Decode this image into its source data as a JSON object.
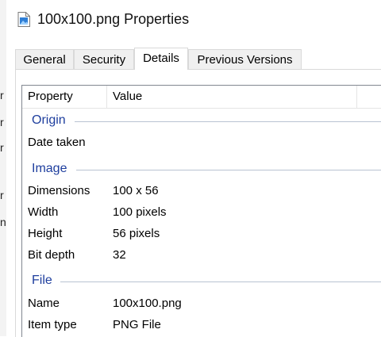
{
  "window": {
    "title": "100x100.png Properties",
    "icon": "image-file-icon"
  },
  "background_fragments": [
    "r",
    "r",
    "r",
    "r",
    "n"
  ],
  "tabs": [
    {
      "label": "General",
      "active": false
    },
    {
      "label": "Security",
      "active": false
    },
    {
      "label": "Details",
      "active": true
    },
    {
      "label": "Previous Versions",
      "active": false
    }
  ],
  "details": {
    "columns": [
      "Property",
      "Value"
    ],
    "groups": [
      {
        "name": "Origin",
        "rows": [
          {
            "property": "Date taken",
            "value": ""
          }
        ]
      },
      {
        "name": "Image",
        "rows": [
          {
            "property": "Dimensions",
            "value": "100 x 56"
          },
          {
            "property": "Width",
            "value": "100 pixels"
          },
          {
            "property": "Height",
            "value": "56 pixels"
          },
          {
            "property": "Bit depth",
            "value": "32"
          }
        ]
      },
      {
        "name": "File",
        "rows": [
          {
            "property": "Name",
            "value": "100x100.png"
          },
          {
            "property": "Item type",
            "value": "PNG File"
          }
        ]
      }
    ]
  },
  "colors": {
    "group_heading": "#1e3e9e",
    "tab_inactive_bg": "#f0f0f0",
    "border": "#d9d9d9"
  }
}
